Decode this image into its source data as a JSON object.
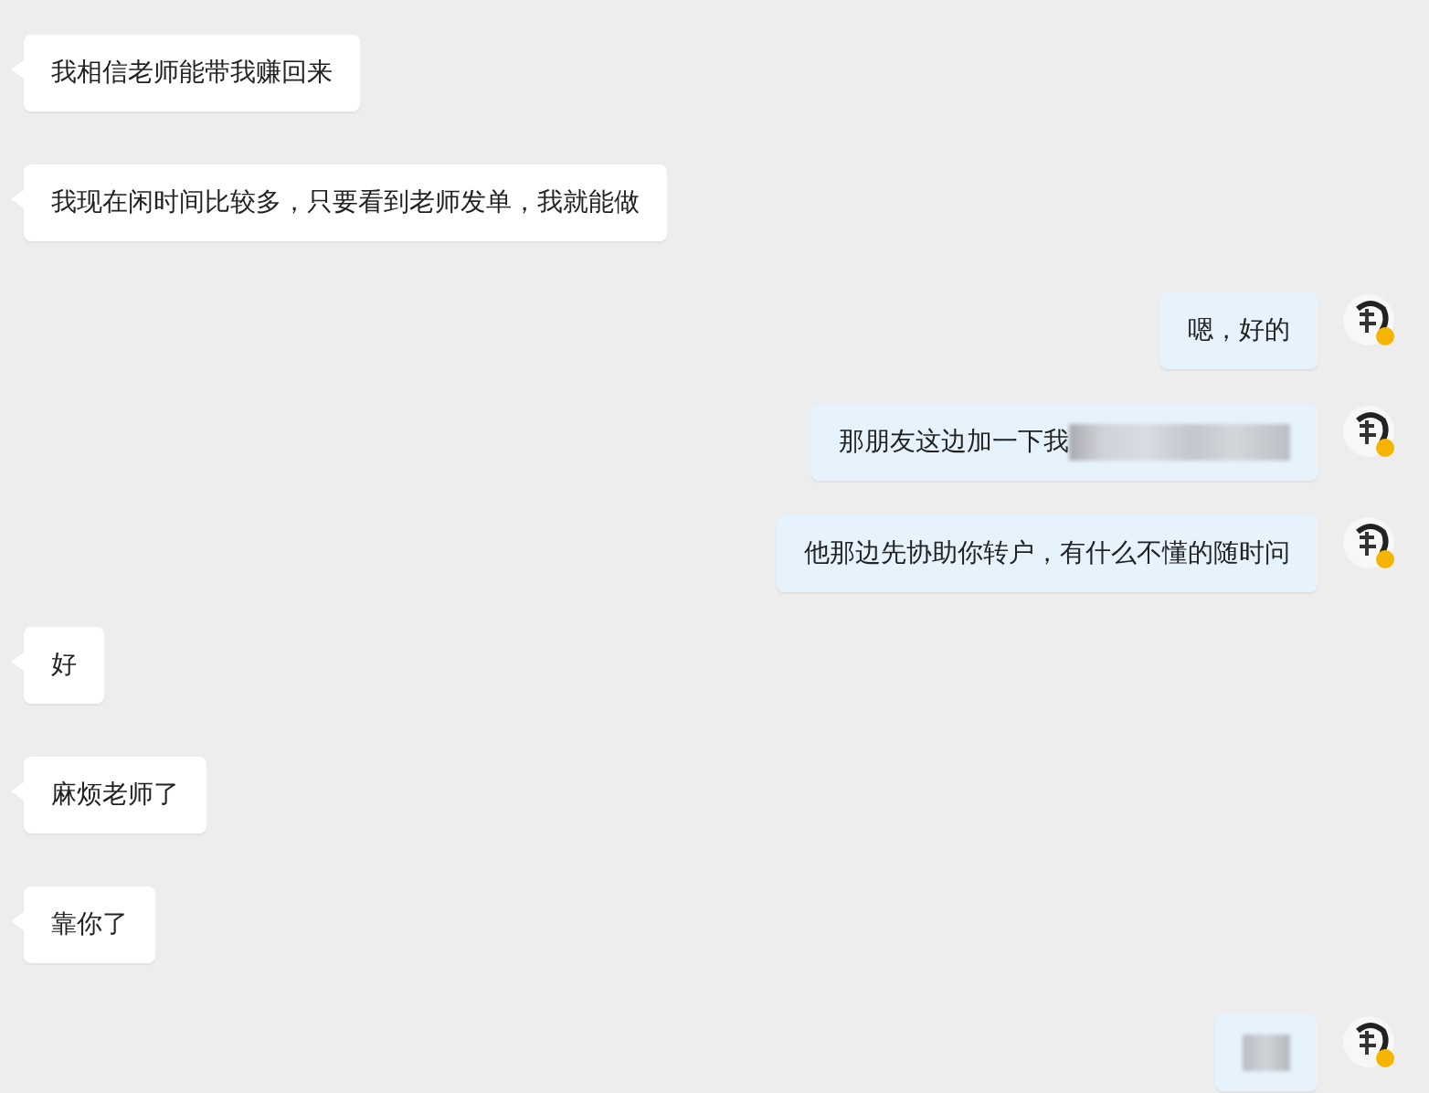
{
  "messages": [
    {
      "outgoing": false,
      "text": "我相信老师能带我赚回来",
      "blurred": false
    },
    {
      "outgoing": false,
      "text": "我现在闲时间比较多，只要看到老师发单，我就能做",
      "blurred": false
    },
    {
      "outgoing": true,
      "text": "嗯，好的",
      "blurred": false
    },
    {
      "outgoing": true,
      "text": "那朋友这边加一下我",
      "blurred": true
    },
    {
      "outgoing": true,
      "text": "他那边先协助你转户，有什么不懂的随时问",
      "blurred": false
    },
    {
      "outgoing": false,
      "text": "好",
      "blurred": false
    },
    {
      "outgoing": false,
      "text": "麻烦老师了",
      "blurred": false
    },
    {
      "outgoing": false,
      "text": "靠你了",
      "blurred": false
    },
    {
      "outgoing": true,
      "blurred": true
    }
  ]
}
